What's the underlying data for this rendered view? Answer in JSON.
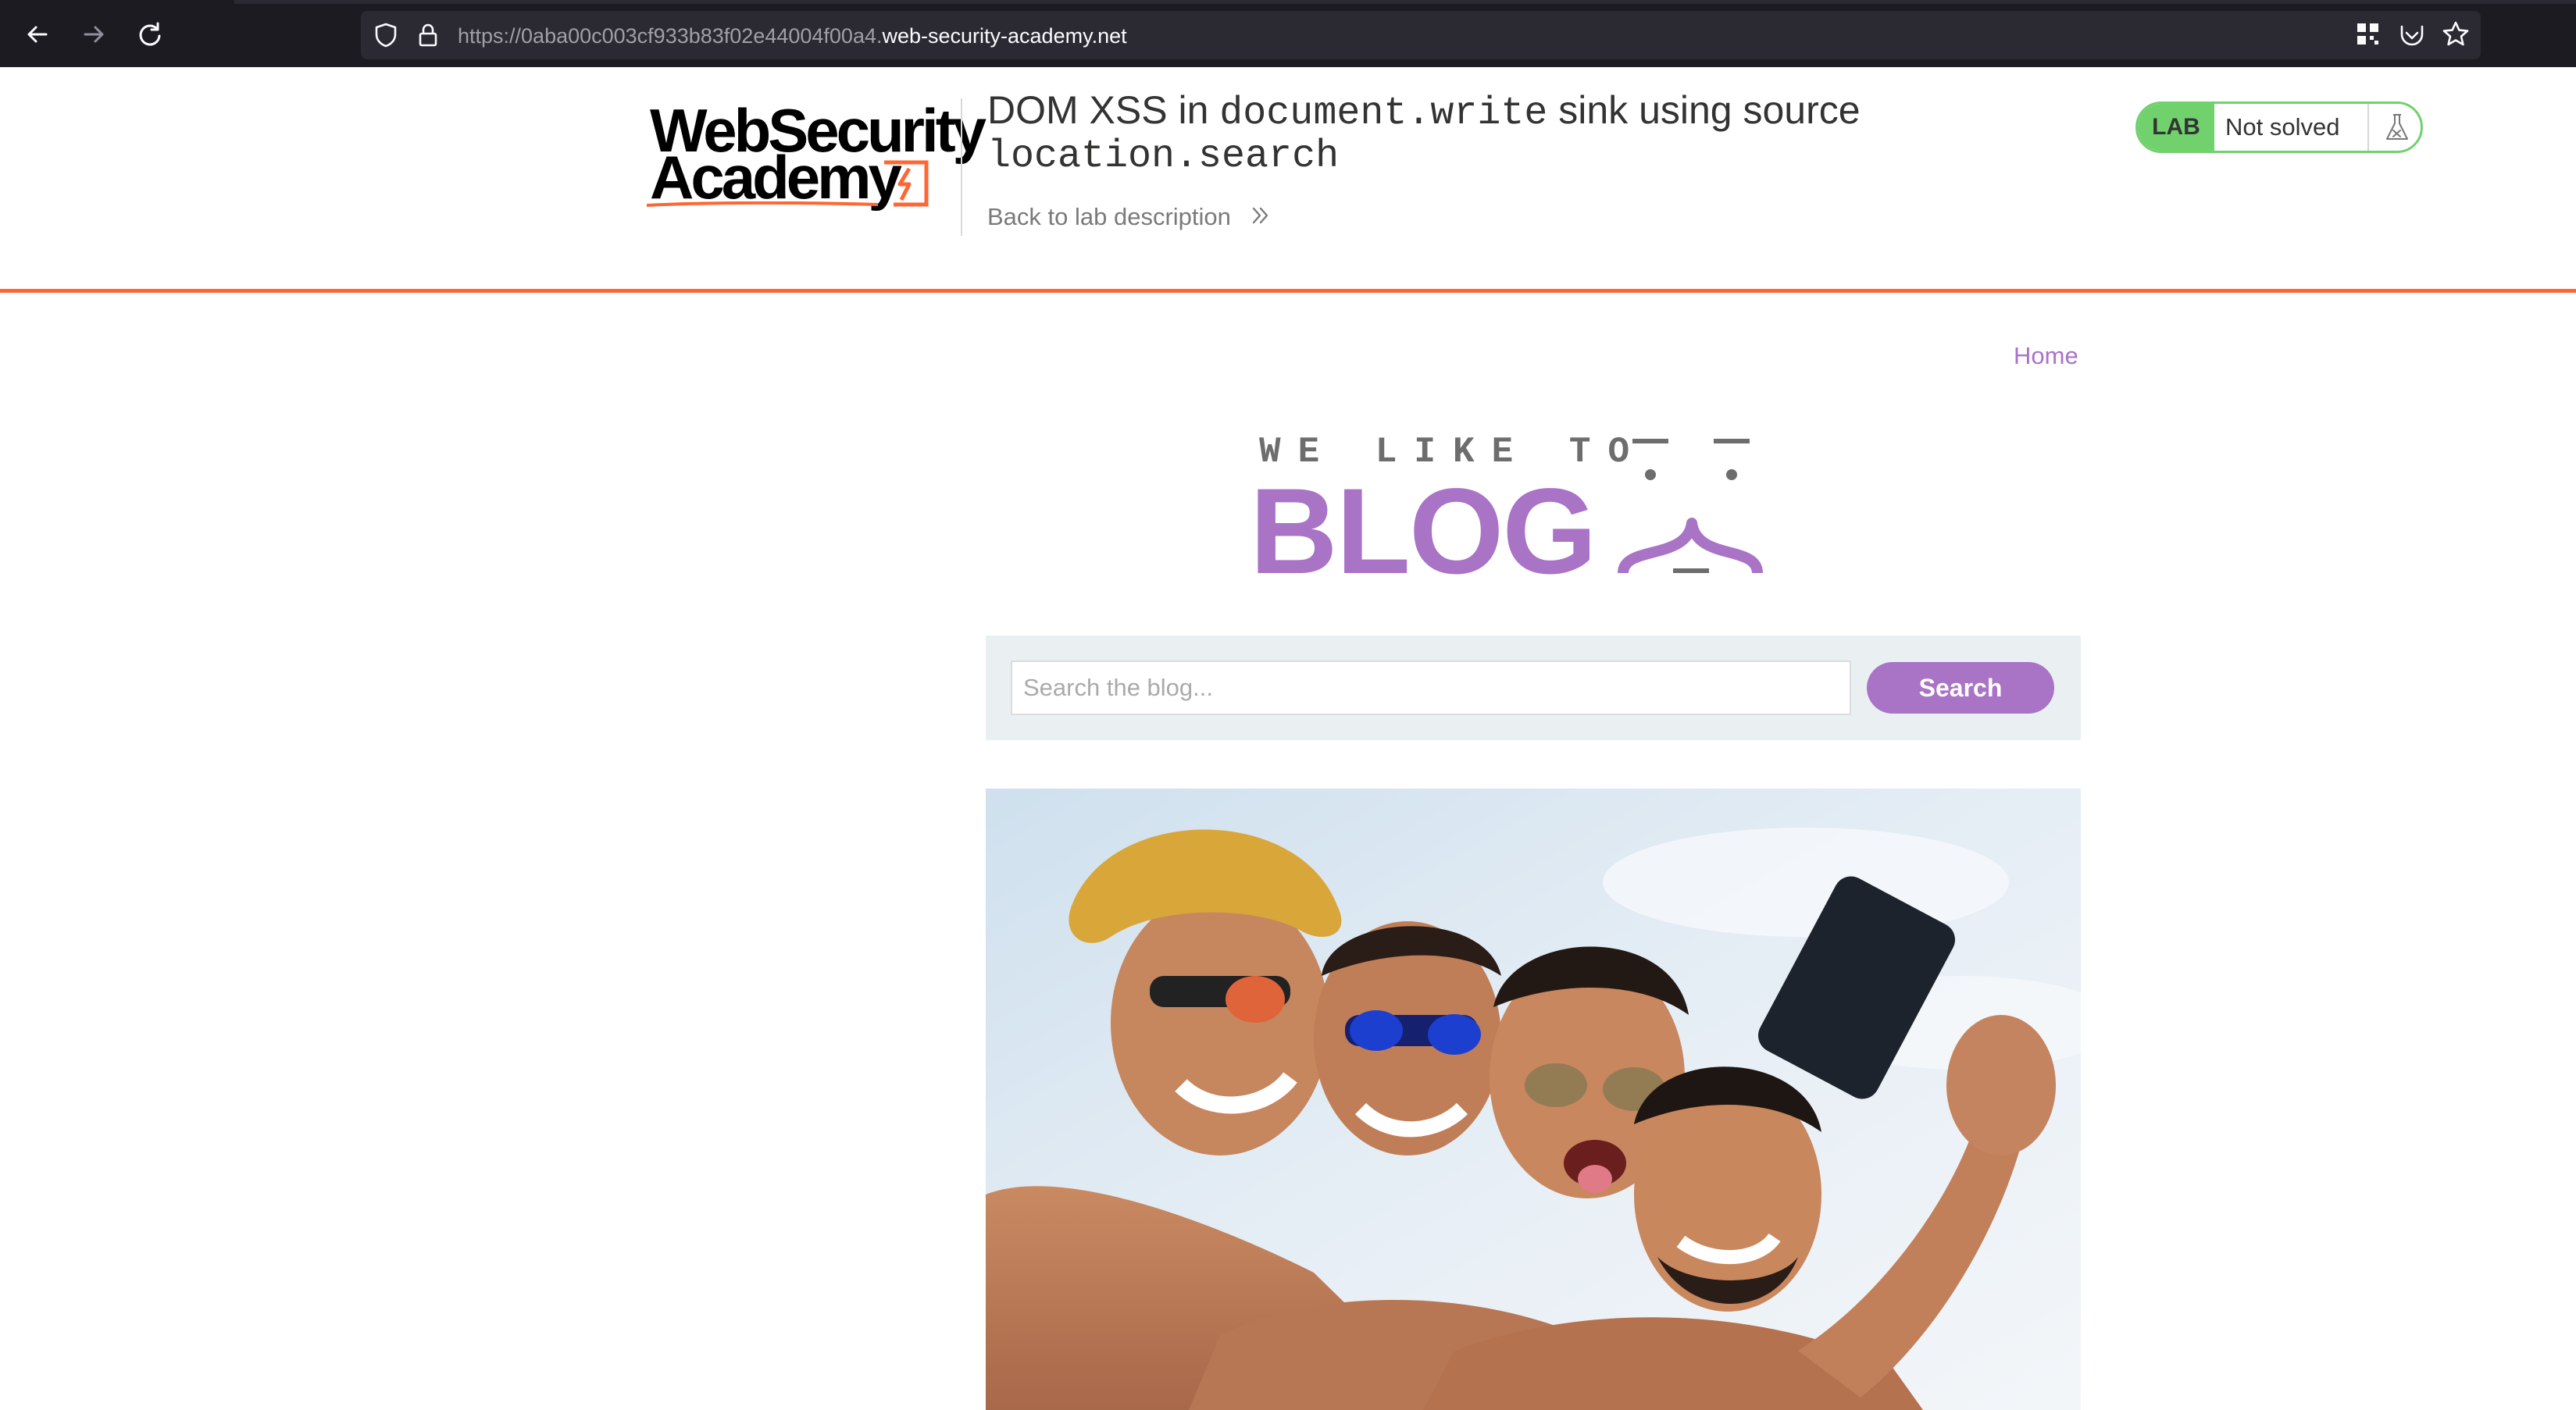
{
  "browser": {
    "url_prefix": "https://0aba00c003cf933b83f02e44004f00a4.",
    "url_host": "web-security-academy.net"
  },
  "header": {
    "logo_line1": "WebSecurity",
    "logo_line2": "Academy",
    "title_part1": "DOM XSS in ",
    "title_code1": "document.write",
    "title_part2": " sink using source",
    "title_code2": "location.search",
    "back_link": "Back to lab description",
    "badge_label": "LAB",
    "badge_status": "Not solved"
  },
  "nav": {
    "home": "Home"
  },
  "blog_logo": {
    "tagline": "WE LIKE TO",
    "word": "BLOG"
  },
  "search": {
    "placeholder": "Search the blog...",
    "button": "Search"
  },
  "colors": {
    "accent": "#a973c6",
    "lab_green": "#70d16d",
    "orange": "#ff6633"
  }
}
